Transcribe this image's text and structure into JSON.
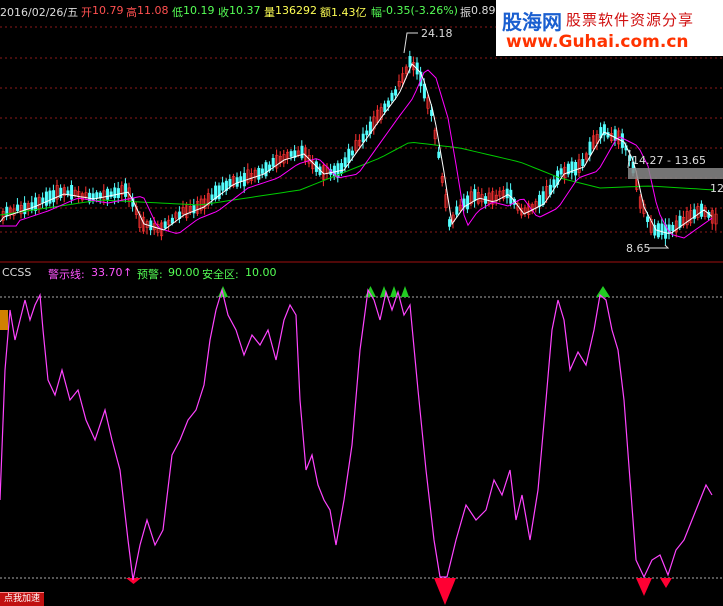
{
  "header": {
    "date": "2016/02/26/五",
    "open_label": "开",
    "open_value": "10.79",
    "high_label": "高",
    "high_value": "11.08",
    "low_label": "低",
    "low_value": "10.19",
    "close_label": "收",
    "close_value": "10.37",
    "volume_label": "量",
    "volume_value": "136292",
    "amount_label": "额",
    "amount_value": "1.43亿",
    "change_label": "幅",
    "change_value": "-0.35(-3.26%)",
    "amplitude_label": "振",
    "amplitude_value": "0.89"
  },
  "logo": {
    "name": "股海网",
    "slogan": "股票软件资源分享",
    "url": "www.Guhai.com.cn"
  },
  "price_chart": {
    "annotations": {
      "peak": "24.18",
      "range": "14.27 - 13.65",
      "low": "8.65",
      "right_edge": "12"
    }
  },
  "indicator": {
    "name": "CCSS",
    "warn_line_label": "警示线:",
    "warn_line_value": "33.70",
    "alert_label": "预警:",
    "alert_value": "90.00",
    "safe_label": "安全区:",
    "safe_value": "10.00"
  },
  "buttons": {
    "speed_up": "点我加速"
  },
  "colors": {
    "background": "#000000",
    "up_candle": "#ff3232",
    "down_candle": "#54ffff",
    "ma_white": "#ffffff",
    "ma_magenta": "#ff00ff",
    "ma_green": "#00cc00",
    "oscillator": "#ff44ff",
    "top_marker": "#22cc22",
    "bottom_marker": "#ff0033"
  }
}
